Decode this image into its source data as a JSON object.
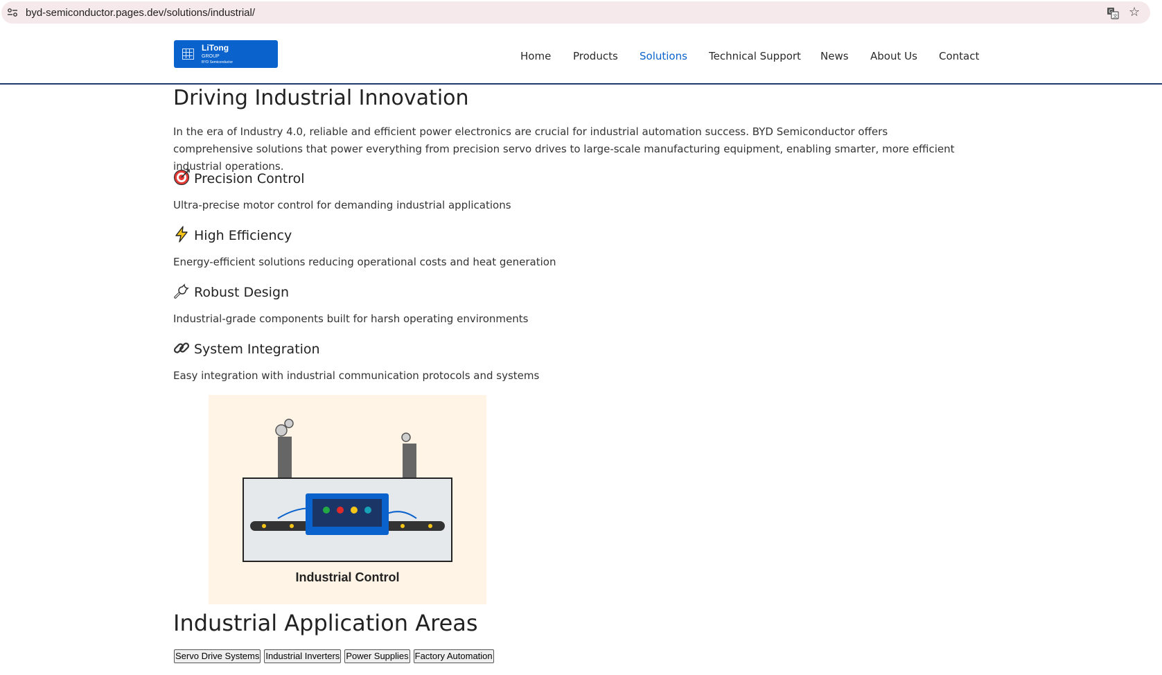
{
  "browser": {
    "url": "byd-semiconductor.pages.dev/solutions/industrial/"
  },
  "header": {
    "logo": {
      "name": "LiTong",
      "sub": "GROUP",
      "tagline": "BYD Semiconductor"
    },
    "nav": [
      {
        "label": "Home",
        "active": false
      },
      {
        "label": "Products",
        "active": false
      },
      {
        "label": "Solutions",
        "active": true
      },
      {
        "label": "Technical Support",
        "active": false
      },
      {
        "label": "News",
        "active": false
      },
      {
        "label": "About Us",
        "active": false
      },
      {
        "label": "Contact",
        "active": false
      }
    ]
  },
  "main": {
    "title": "Driving Industrial Innovation",
    "intro": "In the era of Industry 4.0, reliable and efficient power electronics are crucial for industrial automation success. BYD Semiconductor offers comprehensive solutions that power everything from precision servo drives to large-scale manufacturing equipment, enabling smarter, more efficient industrial operations.",
    "features": [
      {
        "icon": "target-icon",
        "title": "Precision Control",
        "desc": "Ultra-precise motor control for demanding industrial applications"
      },
      {
        "icon": "lightning-icon",
        "title": "High Efficiency",
        "desc": "Energy-efficient solutions reducing operational costs and heat generation"
      },
      {
        "icon": "wrench-icon",
        "title": "Robust Design",
        "desc": "Industrial-grade components built for harsh operating environments"
      },
      {
        "icon": "link-icon",
        "title": "System Integration",
        "desc": "Easy integration with industrial communication protocols and systems"
      }
    ],
    "illustration": {
      "label": "Industrial Control",
      "colors": {
        "background": "#fff4e5",
        "panel": "#0a63cc",
        "led": [
          "#22aa44",
          "#e02a2a",
          "#f5c518",
          "#17a2b8"
        ]
      }
    },
    "applications_title": "Industrial Application Areas",
    "applications": [
      "Servo Drive Systems",
      "Industrial Inverters",
      "Power Supplies",
      "Factory Automation"
    ]
  },
  "colors": {
    "accent": "#0a63cc",
    "header_border": "#1e3a6b"
  }
}
